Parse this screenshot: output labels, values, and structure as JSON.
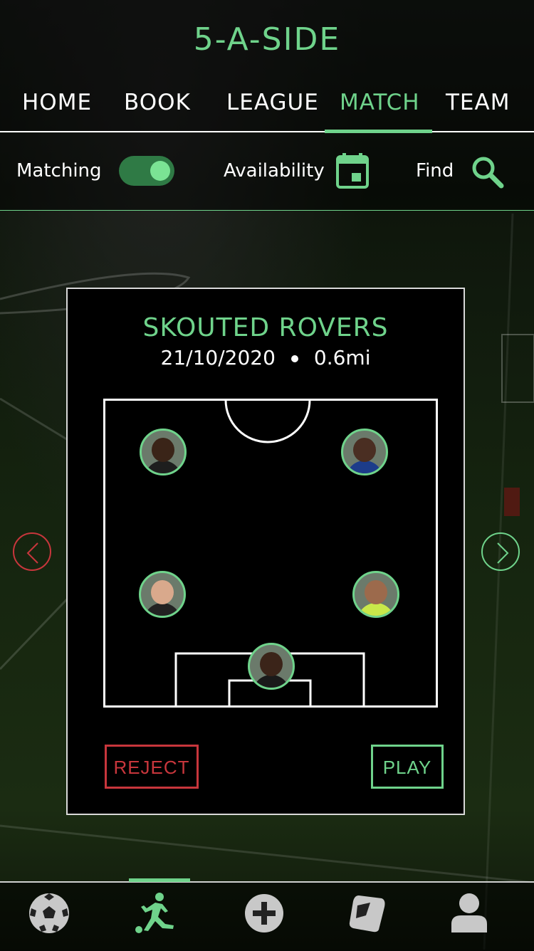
{
  "app": {
    "title": "5-A-SIDE"
  },
  "nav": {
    "items": [
      {
        "label": "HOME",
        "active": false
      },
      {
        "label": "BOOK",
        "active": false
      },
      {
        "label": "LEAGUE",
        "active": false
      },
      {
        "label": "MATCH",
        "active": true
      },
      {
        "label": "TEAM",
        "active": false
      }
    ]
  },
  "controls": {
    "matching_label": "Matching",
    "matching_on": true,
    "availability_label": "Availability",
    "find_label": "Find"
  },
  "match_card": {
    "team_name": "SKOUTED ROVERS",
    "date": "21/10/2020",
    "distance": "0.6mi",
    "players": [
      {
        "role": "forward-left",
        "skin": "#3a2418",
        "kit": "#1e1e1e"
      },
      {
        "role": "forward-right",
        "skin": "#4a2e22",
        "kit": "#1c3c8a"
      },
      {
        "role": "defender-left",
        "skin": "#d9a98c",
        "kit": "#222222"
      },
      {
        "role": "defender-right",
        "skin": "#9c6a4c",
        "kit": "#c9e84a"
      },
      {
        "role": "goalkeeper",
        "skin": "#3b2419",
        "kit": "#1a1a1a"
      }
    ],
    "reject_label": "REJECT",
    "play_label": "PLAY"
  },
  "tabbar": {
    "items": [
      {
        "icon": "football-icon",
        "active": false
      },
      {
        "icon": "player-kick-icon",
        "active": true
      },
      {
        "icon": "add-icon",
        "active": false
      },
      {
        "icon": "pad-icon",
        "active": false
      },
      {
        "icon": "profile-icon",
        "active": false
      }
    ]
  },
  "colors": {
    "accent": "#6fd38b",
    "reject": "#c8363c",
    "inactive_icon": "#c8c8c8"
  }
}
